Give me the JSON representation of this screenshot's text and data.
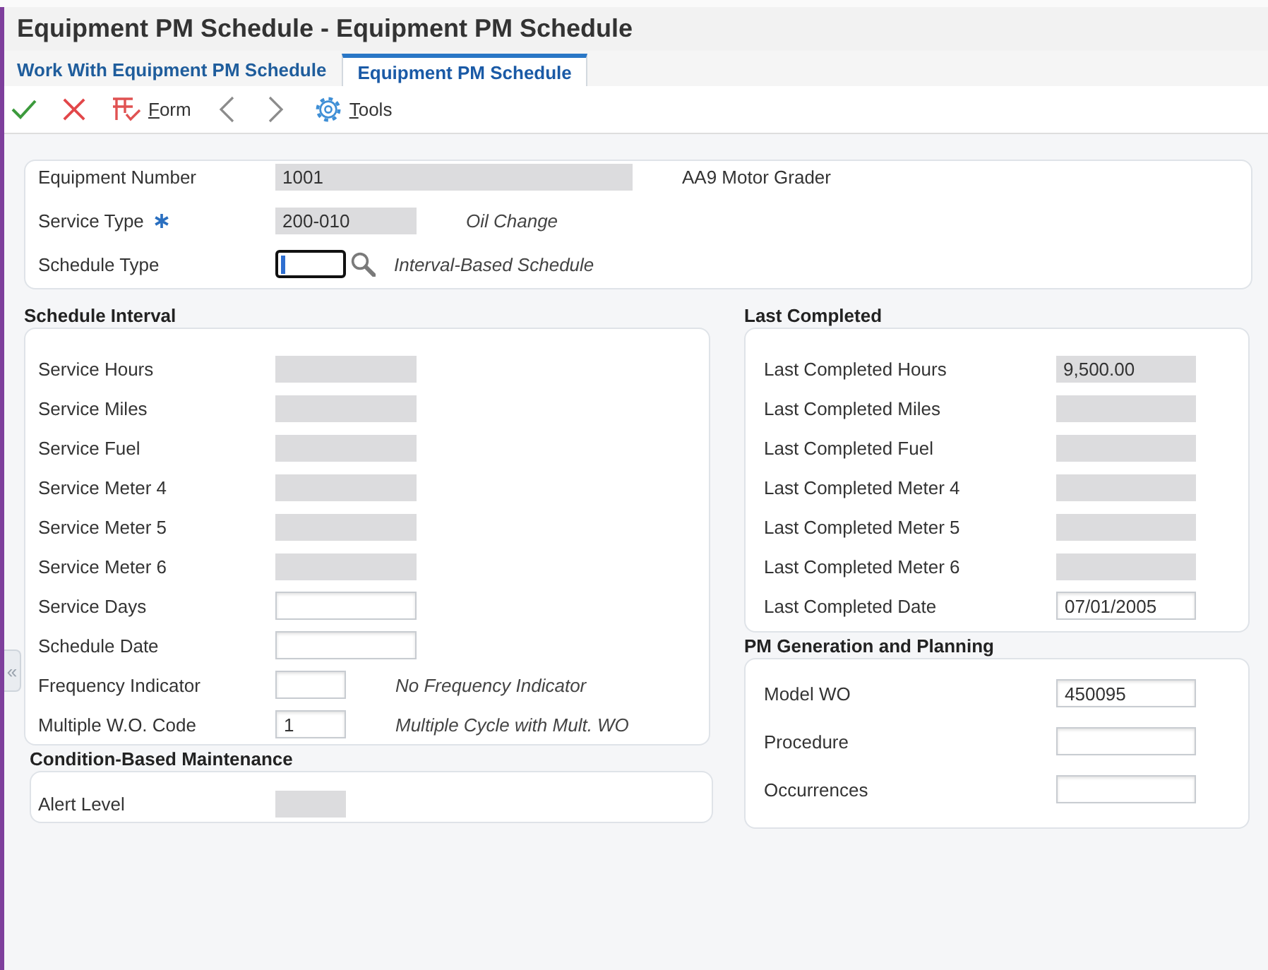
{
  "window": {
    "title": "Equipment PM Schedule - Equipment PM Schedule"
  },
  "tabs": [
    {
      "label": "Work With Equipment PM Schedule",
      "selected": false
    },
    {
      "label": "Equipment PM Schedule",
      "selected": true
    }
  ],
  "toolbar": [
    {
      "kind": "ok"
    },
    {
      "kind": "cancel"
    },
    {
      "kind": "form",
      "label": "Form"
    },
    {
      "kind": "previous"
    },
    {
      "kind": "next"
    },
    {
      "kind": "tools",
      "label": "Tools"
    }
  ],
  "collapse_handle": {
    "label": "«"
  },
  "header": {
    "fields": [
      {
        "label": "Equipment Number",
        "kind": "readonly",
        "value": "1001",
        "required": false,
        "focused": false,
        "lookup": false,
        "caption": "AA9 Motor Grader"
      },
      {
        "label": "Service Type",
        "kind": "readonly",
        "value": "200-010",
        "required": true,
        "focused": false,
        "lookup": false,
        "description": "Oil Change"
      },
      {
        "label": "Schedule Type",
        "kind": "input",
        "required": false,
        "focused": true,
        "lookup": true,
        "description": "Interval-Based Schedule"
      }
    ]
  },
  "columns": [
    {
      "sections": [
        {
          "title": "Schedule Interval",
          "fields": [
            {
              "label": "Service Hours",
              "kind": "readonly"
            },
            {
              "label": "Service Miles",
              "kind": "readonly"
            },
            {
              "label": "Service Fuel",
              "kind": "readonly"
            },
            {
              "label": "Service Meter 4",
              "kind": "readonly"
            },
            {
              "label": "Service Meter 5",
              "kind": "readonly"
            },
            {
              "label": "Service Meter 6",
              "kind": "readonly"
            },
            {
              "label": "Service Days",
              "kind": "input"
            },
            {
              "label": "Schedule Date",
              "kind": "input"
            },
            {
              "label": "Frequency Indicator",
              "kind": "input",
              "description": "No Frequency Indicator"
            },
            {
              "label": "Multiple W.O. Code",
              "kind": "input",
              "value": "1",
              "description": "Multiple Cycle with Mult. WO"
            }
          ]
        },
        {
          "title": "Condition-Based Maintenance",
          "fields": [
            {
              "label": "Alert Level",
              "kind": "readonly"
            }
          ]
        }
      ]
    },
    {
      "sections": [
        {
          "title": "Last Completed",
          "fields": [
            {
              "label": "Last Completed Hours",
              "kind": "readonly",
              "value": "9,500.00"
            },
            {
              "label": "Last Completed Miles",
              "kind": "readonly"
            },
            {
              "label": "Last Completed Fuel",
              "kind": "readonly"
            },
            {
              "label": "Last Completed Meter 4",
              "kind": "readonly"
            },
            {
              "label": "Last Completed Meter 5",
              "kind": "readonly"
            },
            {
              "label": "Last Completed Meter 6",
              "kind": "readonly"
            },
            {
              "label": "Last Completed Date",
              "kind": "input",
              "value": "07/01/2005"
            }
          ]
        },
        {
          "title": "PM Generation and Planning",
          "fields": [
            {
              "label": "Model WO",
              "kind": "input",
              "value": "450095"
            },
            {
              "label": "Procedure",
              "kind": "input"
            },
            {
              "label": "Occurrences",
              "kind": "input"
            }
          ]
        }
      ]
    }
  ]
}
